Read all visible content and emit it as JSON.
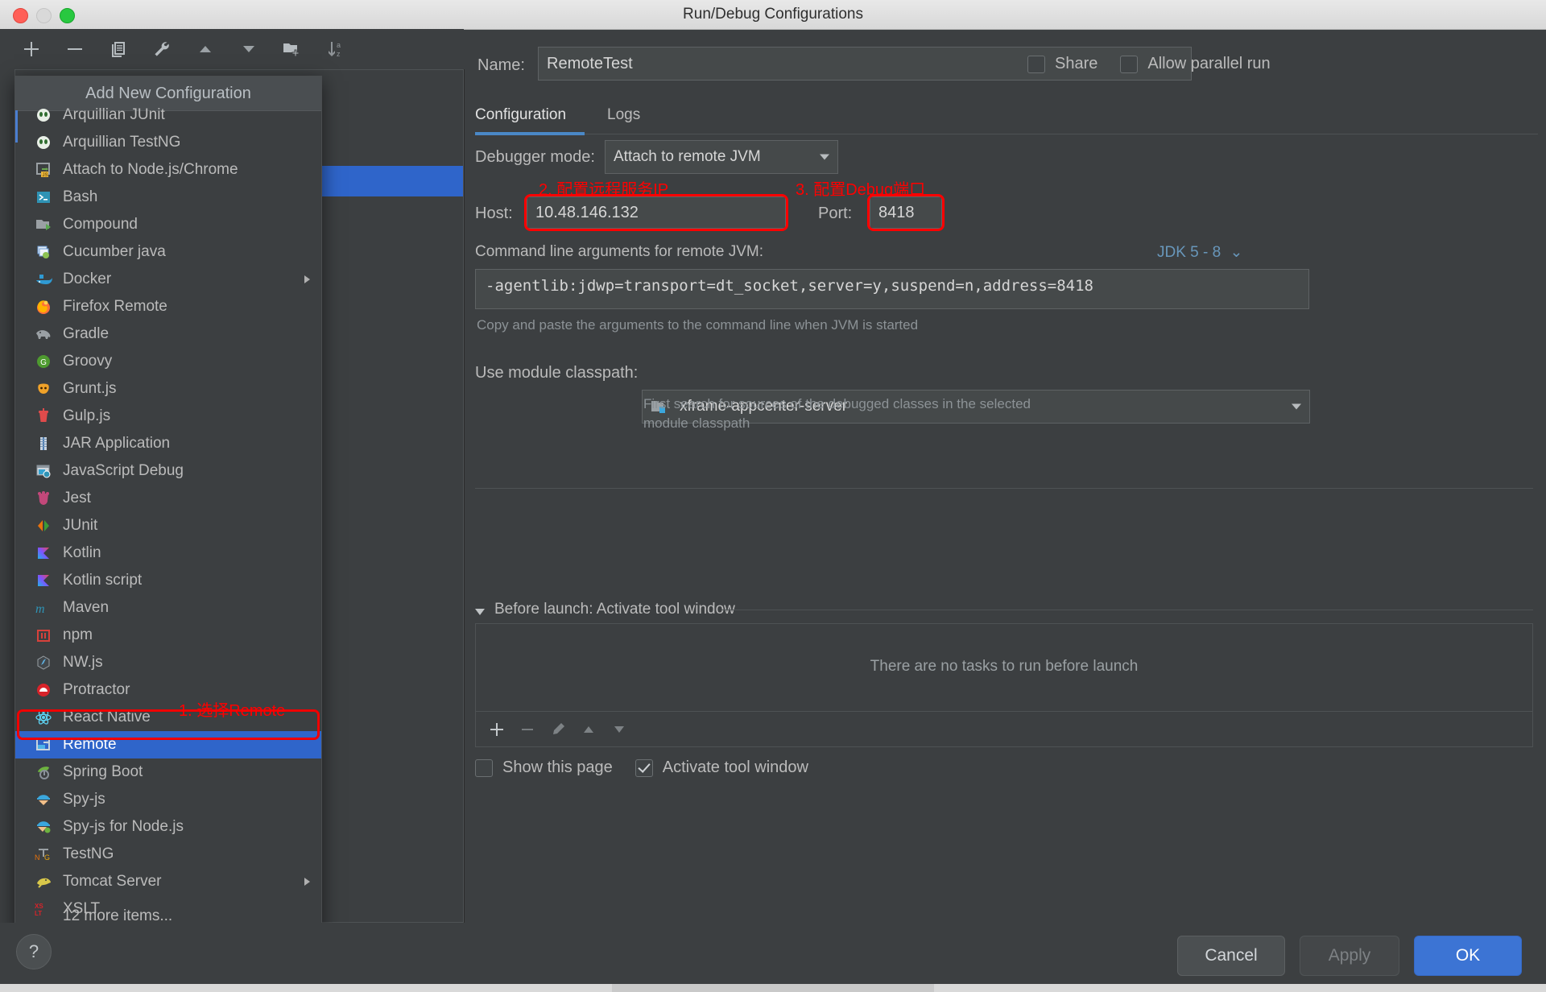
{
  "window": {
    "title": "Run/Debug Configurations",
    "traffic": [
      "close-button",
      "minimize-button",
      "maximize-button"
    ]
  },
  "toolbar": {
    "buttons": [
      {
        "name": "add-configuration-button",
        "icon": "plus-icon"
      },
      {
        "name": "remove-configuration-button",
        "icon": "minus-icon"
      },
      {
        "name": "copy-configuration-button",
        "icon": "copy-icon"
      },
      {
        "name": "edit-templates-button",
        "icon": "wrench-icon"
      },
      {
        "name": "move-up-button",
        "icon": "arrow-up-icon"
      },
      {
        "name": "move-down-button",
        "icon": "arrow-down-icon"
      },
      {
        "name": "new-folder-button",
        "icon": "folder-add-icon"
      },
      {
        "name": "sort-alphabetically-button",
        "icon": "sort-az-icon"
      }
    ]
  },
  "popup": {
    "header": "Add New Configuration",
    "selected": "Remote",
    "more_items": "12 more items...",
    "items": [
      {
        "label": "Arquillian JUnit",
        "icon": "arquillian-junit-icon",
        "submenu": false
      },
      {
        "label": "Arquillian TestNG",
        "icon": "arquillian-testng-icon",
        "submenu": false
      },
      {
        "label": "Attach to Node.js/Chrome",
        "icon": "attach-node-icon",
        "submenu": false
      },
      {
        "label": "Bash",
        "icon": "bash-terminal-icon",
        "submenu": false
      },
      {
        "label": "Compound",
        "icon": "compound-icon",
        "submenu": false
      },
      {
        "label": "Cucumber java",
        "icon": "cucumber-java-icon",
        "submenu": false
      },
      {
        "label": "Docker",
        "icon": "docker-whale-icon",
        "submenu": true
      },
      {
        "label": "Firefox Remote",
        "icon": "firefox-icon",
        "submenu": false
      },
      {
        "label": "Gradle",
        "icon": "gradle-elephant-icon",
        "submenu": false
      },
      {
        "label": "Groovy",
        "icon": "groovy-icon",
        "submenu": false
      },
      {
        "label": "Grunt.js",
        "icon": "grunt-icon",
        "submenu": false
      },
      {
        "label": "Gulp.js",
        "icon": "gulp-icon",
        "submenu": false
      },
      {
        "label": "JAR Application",
        "icon": "jar-icon",
        "submenu": false
      },
      {
        "label": "JavaScript Debug",
        "icon": "javascript-debug-icon",
        "submenu": false
      },
      {
        "label": "Jest",
        "icon": "jest-icon",
        "submenu": false
      },
      {
        "label": "JUnit",
        "icon": "junit-icon",
        "submenu": false
      },
      {
        "label": "Kotlin",
        "icon": "kotlin-icon",
        "submenu": false
      },
      {
        "label": "Kotlin script",
        "icon": "kotlin-script-icon",
        "submenu": false
      },
      {
        "label": "Maven",
        "icon": "maven-icon",
        "submenu": false
      },
      {
        "label": "npm",
        "icon": "npm-icon",
        "submenu": false
      },
      {
        "label": "NW.js",
        "icon": "nwjs-icon",
        "submenu": false
      },
      {
        "label": "Protractor",
        "icon": "protractor-icon",
        "submenu": false
      },
      {
        "label": "React Native",
        "icon": "react-native-icon",
        "submenu": false
      },
      {
        "label": "Remote",
        "icon": "remote-icon",
        "submenu": false
      },
      {
        "label": "Spring Boot",
        "icon": "spring-boot-icon",
        "submenu": false
      },
      {
        "label": "Spy-js",
        "icon": "spyjs-icon",
        "submenu": false
      },
      {
        "label": "Spy-js for Node.js",
        "icon": "spyjs-node-icon",
        "submenu": false
      },
      {
        "label": "TestNG",
        "icon": "testng-icon",
        "submenu": false
      },
      {
        "label": "Tomcat Server",
        "icon": "tomcat-icon",
        "submenu": true
      },
      {
        "label": "XSLT",
        "icon": "xslt-icon",
        "submenu": false
      }
    ]
  },
  "form": {
    "name_label": "Name:",
    "name_value": "RemoteTest",
    "share_label": "Share",
    "share_checked": false,
    "parallel_label": "Allow parallel run",
    "parallel_checked": false,
    "tabs": [
      {
        "label": "Configuration",
        "active": true
      },
      {
        "label": "Logs",
        "active": false
      }
    ],
    "debugger_mode_label": "Debugger mode:",
    "debugger_mode_value": "Attach to remote JVM",
    "host_label": "Host:",
    "host_value": "10.48.146.132",
    "port_label": "Port:",
    "port_value": "8418",
    "args_label": "Command line arguments for remote JVM:",
    "args_value": "-agentlib:jdwp=transport=dt_socket,server=y,suspend=n,address=8418",
    "jdk_label": "JDK 5 - 8",
    "args_hint": "Copy and paste the arguments to the command line when JVM is started",
    "classpath_label": "Use module classpath:",
    "classpath_value": "xframe-appcenter-server",
    "classpath_hint_line1": "First search for sources of the debugged classes in the selected",
    "classpath_hint_line2": "module classpath"
  },
  "before_launch": {
    "title": "Before launch: Activate tool window",
    "empty_text": "There are no tasks to run before launch",
    "toolbar": [
      {
        "name": "add-task-button",
        "icon": "plus-icon"
      },
      {
        "name": "remove-task-button",
        "icon": "minus-icon"
      },
      {
        "name": "edit-task-button",
        "icon": "pencil-icon"
      },
      {
        "name": "move-task-up-button",
        "icon": "arrow-up-icon"
      },
      {
        "name": "move-task-down-button",
        "icon": "arrow-down-icon"
      }
    ],
    "show_page_label": "Show this page",
    "show_page_checked": false,
    "activate_label": "Activate tool window",
    "activate_checked": true
  },
  "footer": {
    "help_label": "?",
    "cancel_label": "Cancel",
    "apply_label": "Apply",
    "ok_label": "OK"
  },
  "annotations": [
    {
      "text": "1. 选择Remote",
      "color": "#ff0000"
    },
    {
      "text": "2. 配置远程服务IP",
      "color": "#ff0000"
    },
    {
      "text": "3. 配置Debug端口",
      "color": "#ff0000"
    }
  ],
  "colors": {
    "accent_blue": "#2f65ca",
    "annotation_red": "#ff0000",
    "ok_button": "#3c74d4",
    "jdk_link": "#6897bb"
  }
}
